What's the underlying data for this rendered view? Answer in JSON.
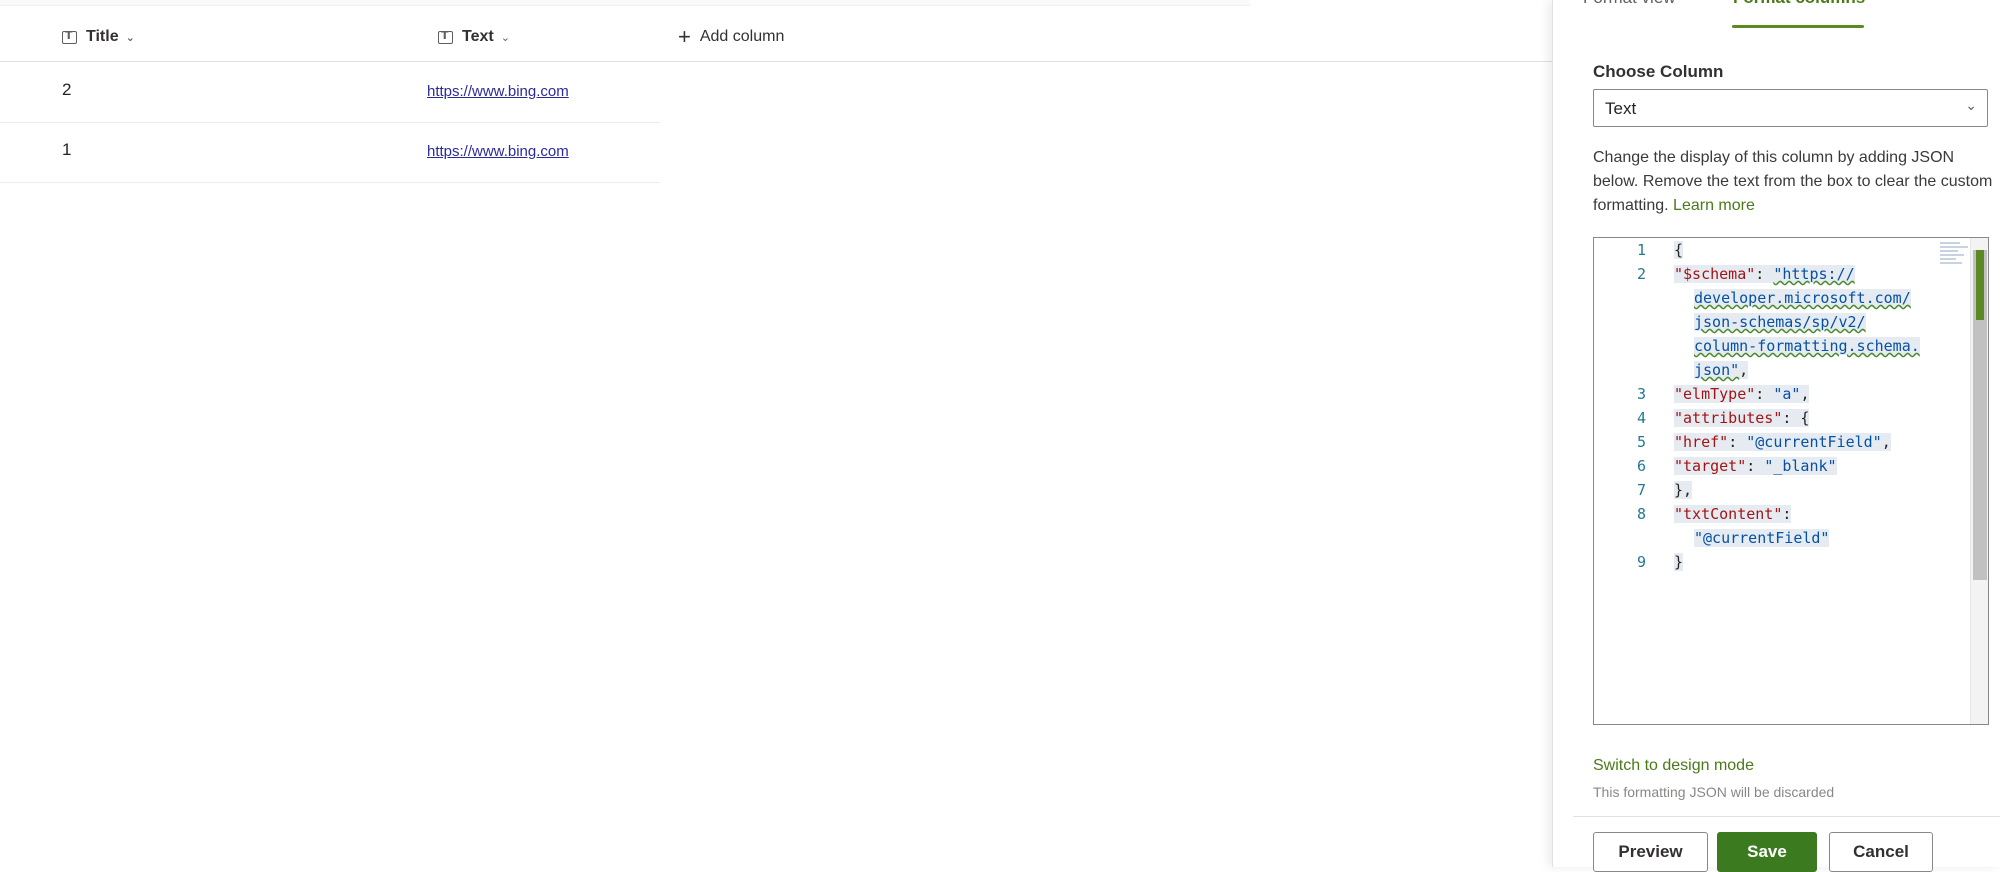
{
  "list": {
    "columns": {
      "title": "Title",
      "text": "Text",
      "add": "Add column"
    },
    "rows": [
      {
        "title": "2",
        "link": "https://www.bing.com"
      },
      {
        "title": "1",
        "link": "https://www.bing.com"
      }
    ]
  },
  "panel": {
    "tabs": {
      "view": "Format view",
      "columns": "Format columns"
    },
    "choose_label": "Choose Column",
    "selected_column": "Text",
    "description": "Change the display of this column by adding JSON below. Remove the text from the box to clear the custom formatting.",
    "learn_more": "Learn more",
    "editor": {
      "line_numbers": [
        "1",
        "2",
        "3",
        "4",
        "5",
        "6",
        "7",
        "8",
        "9"
      ],
      "schema_key": "\"$schema\"",
      "schema_url_parts": [
        "\"https://",
        "developer.microsoft.com/",
        "json-schemas/sp/v2/",
        "column-formatting.schema.",
        "json\""
      ],
      "elmtype_key": "\"elmType\"",
      "elmtype_val": "\"a\"",
      "attributes_key": "\"attributes\"",
      "href_key": "\"href\"",
      "href_val": "\"@currentField\"",
      "target_key": "\"target\"",
      "target_val": "\"_blank\"",
      "txt_key": "\"txtContent\"",
      "txt_val": "\"@currentField\""
    },
    "switch_mode": "Switch to design mode",
    "switch_note": "This formatting JSON will be discarded",
    "buttons": {
      "preview": "Preview",
      "save": "Save",
      "cancel": "Cancel"
    }
  },
  "colors": {
    "accent_green": "#3c7a1f",
    "link_green": "#4a7a1a",
    "link_blue": "#2a2a9c"
  }
}
